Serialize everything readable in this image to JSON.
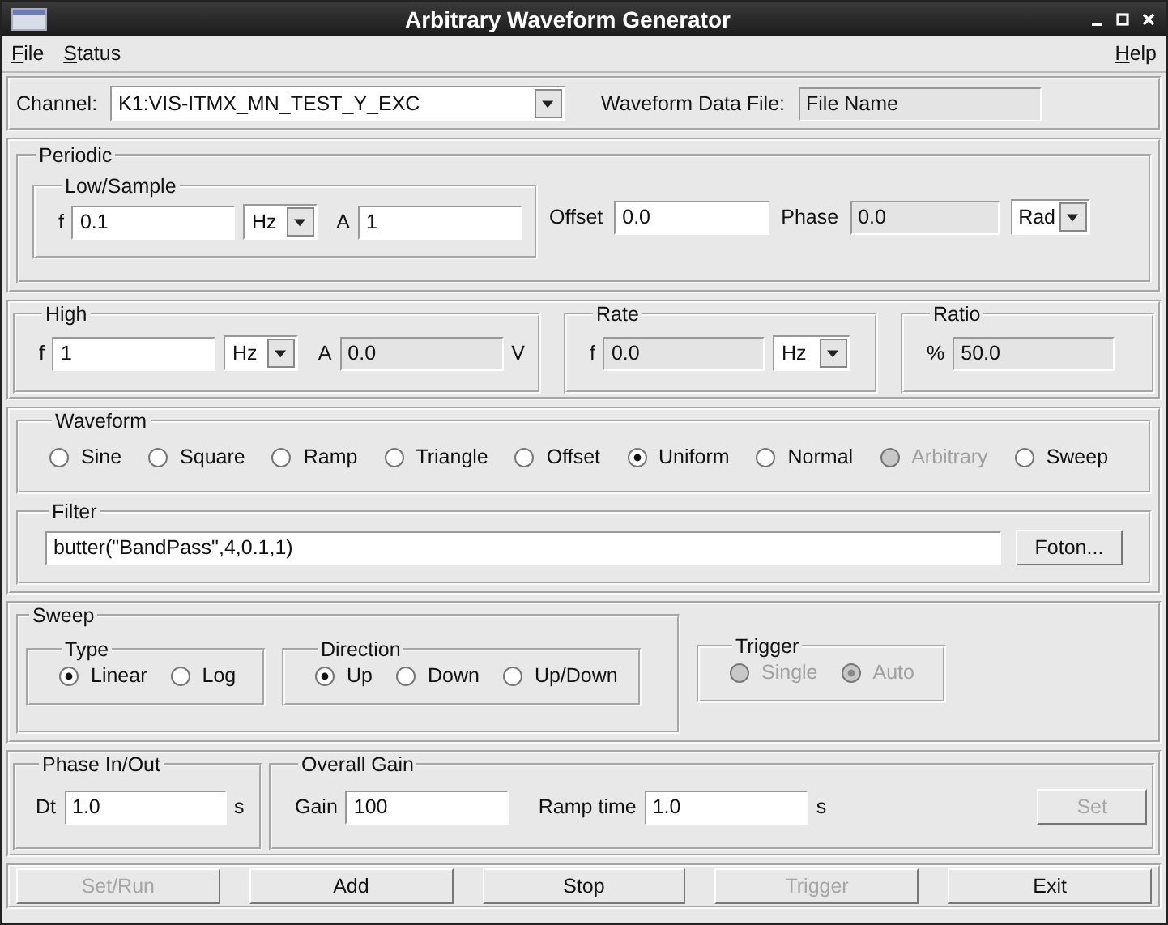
{
  "window": {
    "title": "Arbitrary Waveform Generator"
  },
  "menu": [
    {
      "label": "File"
    },
    {
      "label": "Status"
    },
    {
      "label": "Help"
    }
  ],
  "channel": {
    "label": "Channel:",
    "value": "K1:VIS-ITMX_MN_TEST_Y_EXC"
  },
  "data_file": {
    "label": "Waveform Data File:",
    "value": "File Name",
    "editable": false
  },
  "periodic": {
    "title": "Periodic",
    "low": {
      "title": "Low/Sample",
      "f": {
        "label": "f",
        "value": "0.1",
        "editable": true
      },
      "f_unit": "Hz",
      "a": {
        "label": "A",
        "value": "1",
        "editable": true
      }
    },
    "offset": {
      "label": "Offset",
      "value": "0.0",
      "editable": true
    },
    "phase": {
      "label": "Phase",
      "value": "0.0",
      "editable": false
    },
    "phase_unit": "Rad"
  },
  "high": {
    "title": "High",
    "f": {
      "label": "f",
      "value": "1",
      "editable": true
    },
    "f_unit": "Hz",
    "a": {
      "label": "A",
      "value": "0.0",
      "editable": false
    },
    "a_unit": "V"
  },
  "rate": {
    "title": "Rate",
    "f": {
      "label": "f",
      "value": "0.0",
      "editable": false
    },
    "f_unit": "Hz"
  },
  "ratio": {
    "title": "Ratio",
    "field": {
      "label": "%",
      "value": "50.0",
      "editable": false
    }
  },
  "waveform": {
    "title": "Waveform",
    "options": [
      {
        "label": "Sine",
        "selected": false,
        "disabled": false
      },
      {
        "label": "Square",
        "selected": false,
        "disabled": false
      },
      {
        "label": "Ramp",
        "selected": false,
        "disabled": false
      },
      {
        "label": "Triangle",
        "selected": false,
        "disabled": false
      },
      {
        "label": "Offset",
        "selected": false,
        "disabled": false
      },
      {
        "label": "Uniform",
        "selected": true,
        "disabled": false
      },
      {
        "label": "Normal",
        "selected": false,
        "disabled": false
      },
      {
        "label": "Arbitrary",
        "selected": false,
        "disabled": true
      },
      {
        "label": "Sweep",
        "selected": false,
        "disabled": false
      }
    ]
  },
  "filter": {
    "title": "Filter",
    "value": "butter(\"BandPass\",4,0.1,1)",
    "button": {
      "label": "Foton...",
      "disabled": false
    }
  },
  "sweep": {
    "title": "Sweep",
    "type": {
      "title": "Type",
      "options": [
        {
          "label": "Linear",
          "selected": true,
          "disabled": false
        },
        {
          "label": "Log",
          "selected": false,
          "disabled": false
        }
      ]
    },
    "direction": {
      "title": "Direction",
      "options": [
        {
          "label": "Up",
          "selected": true,
          "disabled": false
        },
        {
          "label": "Down",
          "selected": false,
          "disabled": false
        },
        {
          "label": "Up/Down",
          "selected": false,
          "disabled": false
        }
      ]
    }
  },
  "trigger": {
    "title": "Trigger",
    "options": [
      {
        "label": "Single",
        "selected": false,
        "disabled": true
      },
      {
        "label": "Auto",
        "selected": true,
        "disabled": true
      }
    ]
  },
  "phase_io": {
    "title": "Phase In/Out",
    "dt": {
      "label": "Dt",
      "value": "1.0",
      "editable": true
    },
    "unit": "s"
  },
  "gain": {
    "title": "Overall Gain",
    "gain": {
      "label": "Gain",
      "value": "100",
      "editable": true
    },
    "ramp": {
      "label": "Ramp time",
      "value": "1.0",
      "editable": true
    },
    "unit": "s",
    "button": {
      "label": "Set",
      "disabled": true
    }
  },
  "buttons": [
    {
      "label": "Set/Run",
      "disabled": true
    },
    {
      "label": "Add",
      "disabled": false
    },
    {
      "label": "Stop",
      "disabled": false
    },
    {
      "label": "Trigger",
      "disabled": true
    },
    {
      "label": "Exit",
      "disabled": false
    }
  ]
}
